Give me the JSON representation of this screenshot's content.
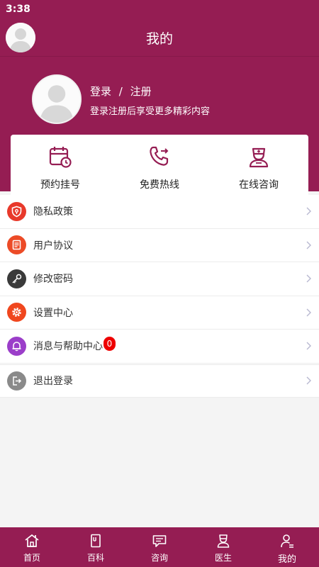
{
  "status_bar": {
    "time": "3:38"
  },
  "nav": {
    "title": "我的"
  },
  "profile": {
    "login": "登录",
    "separator": "/",
    "register": "注册",
    "subtitle": "登录注册后享受更多精彩内容"
  },
  "quick_actions": [
    {
      "label": "预约挂号",
      "icon": "calendar-clock-icon"
    },
    {
      "label": "免费热线",
      "icon": "phone-call-icon"
    },
    {
      "label": "在线咨询",
      "icon": "nurse-icon"
    }
  ],
  "menu": [
    {
      "label": "隐私政策",
      "icon": "shield-icon",
      "color": "#e8392b"
    },
    {
      "label": "用户协议",
      "icon": "document-icon",
      "color": "#ec4b27"
    },
    {
      "label": "修改密码",
      "icon": "key-icon",
      "color": "#3a3a3a"
    },
    {
      "label": "设置中心",
      "icon": "gear-icon",
      "color": "#f0471e"
    },
    {
      "label": "消息与帮助中心",
      "icon": "bell-icon",
      "color": "#9b3ec9",
      "badge": "0"
    },
    {
      "label": "退出登录",
      "icon": "logout-icon",
      "color": "#8a8a8a"
    }
  ],
  "tabs": [
    {
      "label": "首页",
      "icon": "home-icon"
    },
    {
      "label": "百科",
      "icon": "book-icon"
    },
    {
      "label": "咨询",
      "icon": "chat-icon"
    },
    {
      "label": "医生",
      "icon": "doctor-icon"
    },
    {
      "label": "我的",
      "icon": "user-icon",
      "active": true
    }
  ],
  "colors": {
    "brand": "#951d53",
    "badge": "#e00000"
  }
}
